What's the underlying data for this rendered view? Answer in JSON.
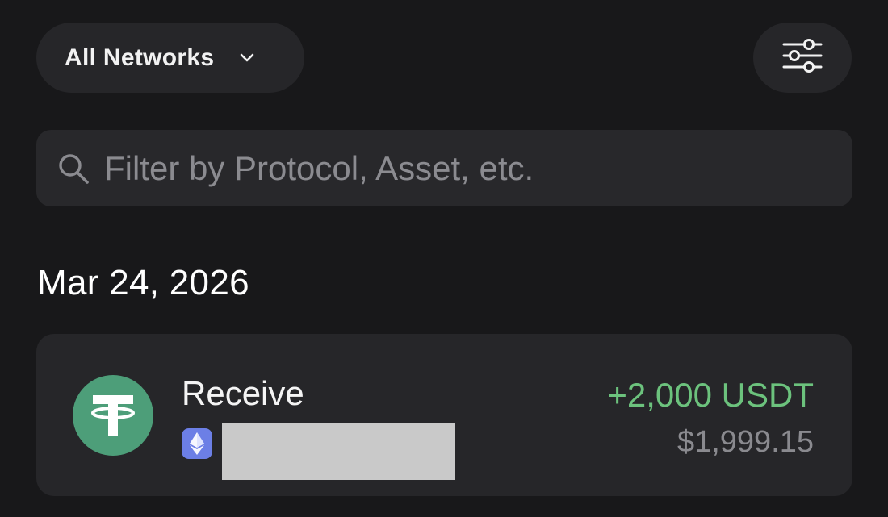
{
  "header": {
    "network_selector": {
      "label": "All Networks",
      "icon": "chevron-down-icon"
    },
    "filter_button": {
      "icon": "sliders-icon"
    }
  },
  "search": {
    "placeholder": "Filter by Protocol, Asset, etc.",
    "value": "",
    "icon": "search-icon"
  },
  "activity": {
    "groups": [
      {
        "date": "Mar 24, 2026",
        "transactions": [
          {
            "type": "Receive",
            "token_icon": "tether-icon",
            "network_icon": "ethereum-icon",
            "amount": "+2,000 USDT",
            "fiat_value": "$1,999.15"
          }
        ]
      }
    ]
  },
  "colors": {
    "background": "#18181a",
    "surface": "#262629",
    "positive": "#6cc27d",
    "muted_text": "#8a8a8f",
    "tether": "#4d9e79",
    "ethereum_badge": "#6c7fe6"
  }
}
